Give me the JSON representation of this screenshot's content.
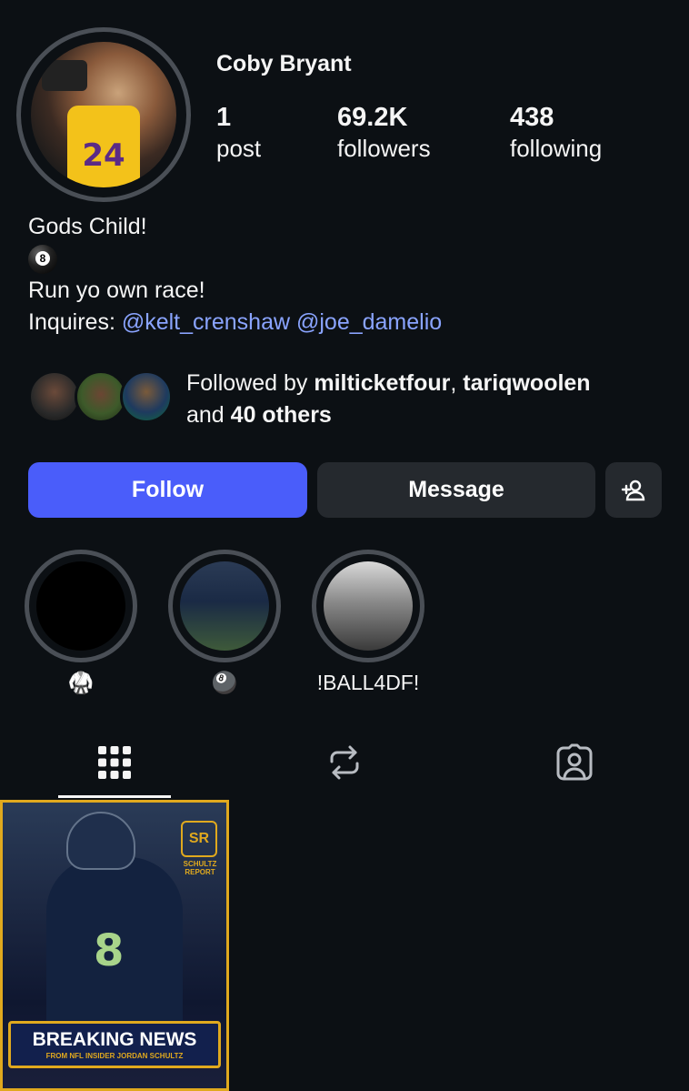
{
  "profile": {
    "username": "Coby Bryant",
    "avatar_jersey_number": "24",
    "stats": {
      "posts_count": "1",
      "posts_label": "post",
      "followers_count": "69.2K",
      "followers_label": "followers",
      "following_count": "438",
      "following_label": "following"
    },
    "bio": {
      "line1": "Gods Child!",
      "line2_icon": "8-ball-emoji",
      "line3": "Run yo own race!",
      "inquires_label": "Inquires:",
      "mention1": "@kelt_crenshaw",
      "mention2": "@joe_damelio"
    },
    "followed_by": {
      "prefix": "Followed by ",
      "user1": "milticketfour",
      "separator": ", ",
      "user2": "tariqwoolen",
      "and": "and ",
      "others": "40 others"
    }
  },
  "actions": {
    "follow_label": "Follow",
    "message_label": "Message",
    "add_user_icon": "add-person-icon"
  },
  "highlights": [
    {
      "label": "🥋"
    },
    {
      "label": "🎱"
    },
    {
      "label": "!BALL4DF!"
    }
  ],
  "tabs": [
    {
      "name": "grid",
      "icon": "grid-icon",
      "active": true
    },
    {
      "name": "reposts",
      "icon": "repost-icon",
      "active": false
    },
    {
      "name": "tagged",
      "icon": "tagged-person-icon",
      "active": false
    }
  ],
  "post": {
    "player_number": "8",
    "logo_text": "SR",
    "logo_caption": "SCHULTZ REPORT",
    "banner_title": "BREAKING NEWS",
    "banner_subtitle": "FROM NFL INSIDER JORDAN SCHULTZ"
  },
  "colors": {
    "background": "#0c1014",
    "follow_button": "#4a5dfa",
    "secondary_button": "#25292e",
    "mention": "#8aa4ff",
    "post_border": "#e0a91e"
  }
}
